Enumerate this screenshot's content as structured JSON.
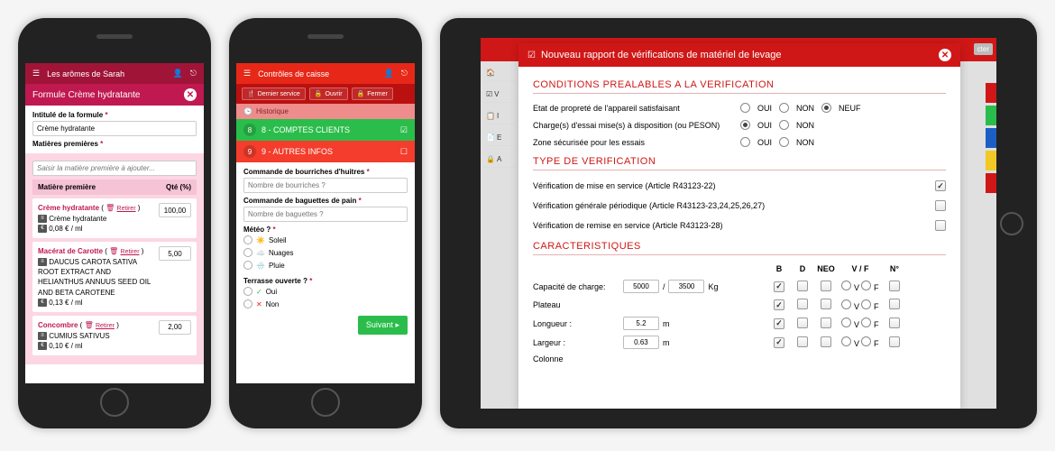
{
  "phone1": {
    "header_title": "Les arômes de Sarah",
    "panel_title": "Formule Crème hydratante",
    "label_intitule": "Intitulé de la formule",
    "value_intitule": "Crème hydratante",
    "label_matieres": "Matières premières",
    "placeholder_matiere": "Saisir la matière première à ajouter...",
    "table_col1": "Matière première",
    "table_col2": "Qté (%)",
    "items": [
      {
        "title": "Crème hydratante",
        "subtitle": "Crème hydratante",
        "extra": "0,08 € / ml",
        "qty": "100,00"
      },
      {
        "title": "Macérat de Carotte",
        "subtitle": "DAUCUS CAROTA SATIVA ROOT EXTRACT AND HELIANTHUS ANNUUS SEED OIL AND BETA CAROTENE",
        "extra": "0,13 € / ml",
        "qty": "5,00"
      },
      {
        "title": "Concombre",
        "subtitle": "CUMIUS SATIVUS",
        "extra": "0,10 € / ml",
        "qty": "2,00"
      }
    ],
    "retire": "Retirer"
  },
  "phone2": {
    "header_title": "Contrôles de caisse",
    "toolbar": {
      "dernier": "Dernier service",
      "ouvrir": "Ouvrir",
      "fermer": "Fermer"
    },
    "historique": "Historique",
    "acc1": {
      "num": "8",
      "title": "8 - COMPTES CLIENTS"
    },
    "acc2": {
      "num": "9",
      "title": "9 - AUTRES INFOS"
    },
    "q_bourriches_label": "Commande de bourriches d'huitres",
    "q_bourriches_ph": "Nombre de bourriches ?",
    "q_baguettes_label": "Commande de baguettes de pain",
    "q_baguettes_ph": "Nombre de baguettes ?",
    "meteo_label": "Météo ?",
    "meteo": {
      "soleil": "Soleil",
      "nuages": "Nuages",
      "pluie": "Pluie"
    },
    "terrasse_label": "Terrasse ouverte ?",
    "oui": "Oui",
    "non": "Non",
    "suivant": "Suivant"
  },
  "tablet": {
    "side_labels": [
      "V",
      "I",
      "E",
      "A"
    ],
    "modal_title": "Nouveau rapport de vérifications de matériel de levage",
    "sec_conditions_title": "CONDITIONS PREALABLES A LA VERIFICATION",
    "cond1": "Etat de propreté de l'appareil satisfaisant",
    "cond2": "Charge(s) d'essai mise(s) à disposition (ou PESON)",
    "cond3": "Zone sécurisée pour les essais",
    "opt_oui": "OUI",
    "opt_non": "NON",
    "opt_neuf": "NEUF",
    "sec_type_title": "TYPE DE VERIFICATION",
    "verif1": "Vérification de mise en service (Article R43123-22)",
    "verif2": "Vérification générale périodique (Article R43123-23,24,25,26,27)",
    "verif3": "Vérification de remise en service (Article R43123-28)",
    "sec_char_title": "CARACTERISTIQUES",
    "cols": {
      "B": "B",
      "D": "D",
      "NEO": "NEO",
      "VF": "V / F",
      "N": "N°"
    },
    "rows": {
      "capacite": "Capacité de charge:",
      "cap_v1": "5000",
      "cap_slash": "/",
      "cap_v2": "3500",
      "cap_unit": "Kg",
      "plateau": "Plateau",
      "longueur": "Longueur :",
      "longueur_v": "5.2",
      "longueur_u": "m",
      "largeur": "Largeur :",
      "largeur_v": "0.63",
      "largeur_u": "m",
      "colonne": "Colonne"
    },
    "vf_v": "V",
    "vf_f": "F",
    "cter": "cter"
  }
}
